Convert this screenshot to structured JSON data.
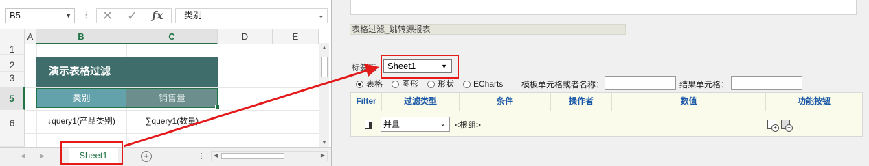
{
  "excel": {
    "name_box": "B5",
    "formula_content": "类别",
    "fx_label": "fx",
    "columns": [
      "A",
      "B",
      "C",
      "D",
      "E"
    ],
    "rows": [
      "1",
      "2",
      "3",
      "5",
      "6"
    ],
    "title_cell": "演示表格过滤",
    "b5": "类别",
    "c5": "销售量",
    "b6": "↓query1(产品类别)",
    "c6": "∑query1(数量)",
    "sheet_tab": "Sheet1"
  },
  "panel": {
    "page_title": "表格过滤_跳转源报表",
    "tab_label": "标签页",
    "sheet_select": "Sheet1",
    "radios": [
      {
        "label": "表格",
        "checked": true
      },
      {
        "label": "图形",
        "checked": false
      },
      {
        "label": "形状",
        "checked": false
      },
      {
        "label": "ECharts",
        "checked": false
      }
    ],
    "template_cell_label": "模板单元格或者名称：",
    "template_cell_value": "",
    "result_cell_label": "结果单元格：",
    "result_cell_value": ""
  },
  "filter_table": {
    "headers": [
      "Filter",
      "过滤类型",
      "条件",
      "操作者",
      "数值",
      "功能按钮"
    ],
    "row": {
      "filter_type": "并且",
      "condition": "<根组>"
    }
  },
  "colors": {
    "excel_green": "#217346",
    "title_band": "#3e6d6b",
    "header_cell_b": "#64a2ab",
    "header_cell_c": "#6c8e8d",
    "annotation_red": "#e31b1b",
    "table_header_text": "#1d5aa8"
  },
  "icons": [
    "dropdown-arrow-icon",
    "cancel-x-icon",
    "check-icon",
    "fx-icon",
    "add-sheet-icon",
    "drag-handle-icon",
    "add-condition-icon",
    "add-group-icon"
  ]
}
